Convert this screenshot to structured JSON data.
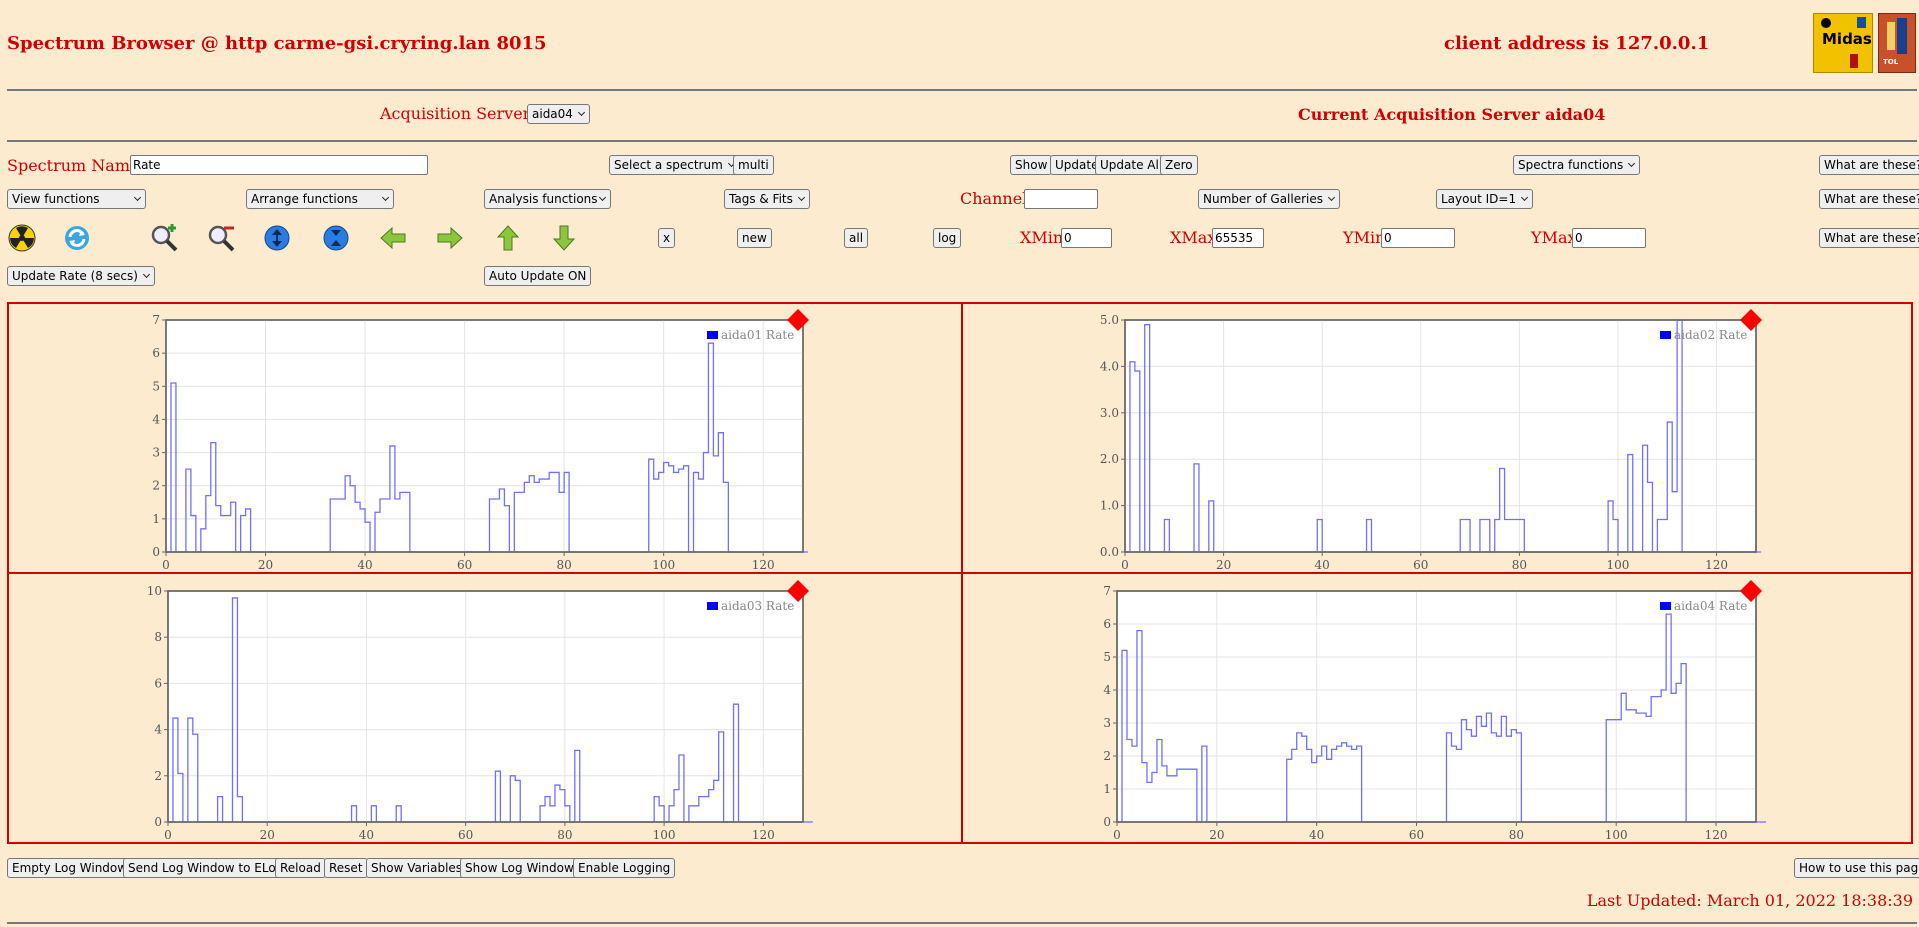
{
  "header": {
    "title": "Spectrum Browser @ http carme-gsi.cryring.lan 8015",
    "client_address": "client address is 127.0.0.1",
    "logos": [
      "Midas",
      "TOL"
    ]
  },
  "acquisition": {
    "label": "Acquisition Servers",
    "selected": "aida04",
    "current": "Current Acquisition Server aida04"
  },
  "row1": {
    "spectrum_label": "Spectrum Name:",
    "spectrum_value": "Rate",
    "select_spectrum": "Select a spectrum",
    "multi": "multi",
    "show": "Show",
    "update": "Update",
    "update_all": "Update All",
    "zero": "Zero",
    "spectra_functions": "Spectra functions",
    "what": "What are these?"
  },
  "row2": {
    "view_functions": "View functions",
    "arrange_functions": "Arrange functions",
    "analysis_functions": "Analysis functions",
    "tags_fits": "Tags & Fits",
    "channel_label": "Channel:",
    "channel_value": "",
    "galleries": "Number of Galleries",
    "layout": "Layout ID=1",
    "what": "What are these?"
  },
  "row3": {
    "x": "x",
    "new": "new",
    "all": "all",
    "log": "log",
    "xmin_label": "XMin",
    "xmin": "0",
    "xmax_label": "XMax",
    "xmax": "65535",
    "ymin_label": "YMin",
    "ymin": "0",
    "ymax_label": "YMax",
    "ymax": "0",
    "what": "What are these?",
    "icons": [
      "radiation-icon",
      "refresh-icon",
      "zoom-in-icon",
      "zoom-out-icon",
      "expand-y-icon",
      "compress-y-icon",
      "arrow-left-icon",
      "arrow-right-icon",
      "arrow-up-icon",
      "arrow-down-icon"
    ]
  },
  "row4": {
    "update_rate": "Update Rate (8 secs)",
    "auto_update": "Auto Update ON"
  },
  "footer": {
    "empty_log": "Empty Log Window",
    "send_log": "Send Log Window to ELog",
    "reload": "Reload",
    "reset": "Reset",
    "show_variables": "Show Variables",
    "show_log": "Show Log Window",
    "enable_logging": "Enable Logging",
    "how_to": "How to use this page",
    "last_updated": "Last Updated: March 01, 2022 18:38:39"
  },
  "colors": {
    "accent": "#d00000",
    "background": "#fdebd0",
    "trace": "#7070ff",
    "legend": "#0000ff",
    "marker": "#ff0000"
  },
  "chart_data": [
    {
      "type": "line",
      "series": [
        {
          "name": "aida01 Rate",
          "x_start": 0,
          "x_step": 1,
          "values": [
            0,
            5.1,
            0,
            0,
            2.5,
            1.1,
            0,
            0.7,
            1.7,
            3.3,
            1.4,
            1.1,
            1.1,
            1.5,
            0,
            1.1,
            1.3,
            0,
            0,
            0,
            0,
            0,
            0,
            0,
            0,
            0,
            0,
            0,
            0,
            0,
            0,
            0,
            0,
            1.6,
            1.6,
            1.6,
            2.3,
            2.0,
            1.5,
            1.3,
            0.9,
            0,
            1.2,
            1.6,
            1.6,
            3.2,
            1.6,
            1.8,
            1.8,
            0,
            0,
            0,
            0,
            0,
            0,
            0,
            0,
            0,
            0,
            0,
            0,
            0,
            0,
            0,
            0,
            1.6,
            1.6,
            1.9,
            1.4,
            0,
            1.8,
            1.8,
            2.1,
            2.3,
            2.1,
            2.2,
            2.2,
            2.4,
            2.4,
            1.8,
            2.4,
            0,
            0,
            0,
            0,
            0,
            0,
            0,
            0,
            0,
            0,
            0,
            0,
            0,
            0,
            0,
            0,
            2.8,
            2.2,
            2.4,
            2.7,
            2.6,
            2.4,
            2.5,
            2.6,
            0,
            2.4,
            2.2,
            3.0,
            6.3,
            2.9,
            3.6,
            2.1,
            0,
            0,
            0,
            0,
            0,
            0,
            0,
            0,
            0,
            0,
            0,
            0,
            0,
            0,
            0,
            0
          ]
        }
      ],
      "xlim": [
        0,
        128
      ],
      "ylim": [
        0,
        7
      ],
      "xticks": [
        0,
        20,
        40,
        60,
        80,
        100,
        120
      ],
      "yticks": [
        0,
        1,
        2,
        3,
        4,
        5,
        6,
        7
      ],
      "ytick_labels": [
        "0",
        "1",
        "2",
        "3",
        "4",
        "5",
        "6",
        "7"
      ],
      "grid": true,
      "legend": "top-right"
    },
    {
      "type": "line",
      "series": [
        {
          "name": "aida02 Rate",
          "x_start": 0,
          "x_step": 1,
          "values": [
            0,
            4.1,
            3.9,
            0,
            4.9,
            0,
            0,
            0,
            0.7,
            0,
            0,
            0,
            0,
            0,
            1.9,
            0,
            0,
            1.1,
            0,
            0,
            0,
            0,
            0,
            0,
            0,
            0,
            0,
            0,
            0,
            0,
            0,
            0,
            0,
            0,
            0,
            0,
            0,
            0,
            0,
            0.7,
            0,
            0,
            0,
            0,
            0,
            0,
            0,
            0,
            0,
            0.7,
            0,
            0,
            0,
            0,
            0,
            0,
            0,
            0,
            0,
            0,
            0,
            0,
            0,
            0,
            0,
            0,
            0,
            0,
            0.7,
            0.7,
            0,
            0,
            0.7,
            0.7,
            0,
            0.7,
            1.8,
            0.7,
            0.7,
            0.7,
            0.7,
            0,
            0,
            0,
            0,
            0,
            0,
            0,
            0,
            0,
            0,
            0,
            0,
            0,
            0,
            0,
            0,
            0,
            1.1,
            0.7,
            0,
            0,
            2.1,
            0,
            0,
            2.3,
            1.5,
            0,
            0.7,
            0.7,
            2.8,
            1.3,
            5.0,
            0,
            0,
            0,
            0,
            0,
            0,
            0,
            0,
            0,
            0,
            0,
            0,
            0,
            0,
            0,
            0
          ]
        }
      ],
      "xlim": [
        0,
        128
      ],
      "ylim": [
        0,
        5
      ],
      "xticks": [
        0,
        20,
        40,
        60,
        80,
        100,
        120
      ],
      "yticks": [
        0,
        1,
        2,
        3,
        4,
        5
      ],
      "ytick_labels": [
        "0.0",
        "1.0",
        "2.0",
        "3.0",
        "4.0",
        "5.0"
      ],
      "grid": true,
      "legend": "top-right"
    },
    {
      "type": "line",
      "series": [
        {
          "name": "aida03 Rate",
          "x_start": 0,
          "x_step": 1,
          "values": [
            0,
            4.5,
            2.1,
            0,
            4.5,
            3.8,
            0,
            0,
            0,
            0,
            1.1,
            0,
            0,
            9.7,
            1.1,
            0,
            0,
            0,
            0,
            0,
            0,
            0,
            0,
            0,
            0,
            0,
            0,
            0,
            0,
            0,
            0,
            0,
            0,
            0,
            0,
            0,
            0,
            0.7,
            0,
            0,
            0,
            0.7,
            0,
            0,
            0,
            0,
            0.7,
            0,
            0,
            0,
            0,
            0,
            0,
            0,
            0,
            0,
            0,
            0,
            0,
            0,
            0,
            0,
            0,
            0,
            0,
            0,
            2.2,
            0,
            0,
            2.0,
            1.8,
            0,
            0,
            0,
            0,
            0.7,
            1.1,
            0.7,
            1.6,
            1.4,
            0.7,
            0,
            3.1,
            0,
            0,
            0,
            0,
            0,
            0,
            0,
            0,
            0,
            0,
            0,
            0,
            0,
            0,
            0,
            1.1,
            0.7,
            0,
            0.7,
            1.4,
            2.9,
            0,
            0.7,
            0.7,
            1.1,
            1.1,
            1.4,
            1.8,
            3.9,
            0,
            0,
            5.1,
            0,
            0,
            0,
            0,
            0,
            0,
            0,
            0,
            0,
            0,
            0,
            0,
            0,
            0,
            0
          ]
        }
      ],
      "xlim": [
        0,
        128
      ],
      "ylim": [
        0,
        10
      ],
      "xticks": [
        0,
        20,
        40,
        60,
        80,
        100,
        120
      ],
      "yticks": [
        0,
        2,
        4,
        6,
        8,
        10
      ],
      "ytick_labels": [
        "0",
        "2",
        "4",
        "6",
        "8",
        "10"
      ],
      "grid": true,
      "legend": "top-right"
    },
    {
      "type": "line",
      "series": [
        {
          "name": "aida04 Rate",
          "x_start": 0,
          "x_step": 1,
          "values": [
            0,
            5.2,
            2.5,
            2.3,
            5.8,
            1.8,
            1.2,
            1.5,
            2.5,
            1.7,
            1.4,
            1.4,
            1.6,
            1.6,
            1.6,
            1.6,
            0,
            2.3,
            0,
            0,
            0,
            0,
            0,
            0,
            0,
            0,
            0,
            0,
            0,
            0,
            0,
            0,
            0,
            0,
            1.9,
            2.2,
            2.7,
            2.6,
            2.2,
            1.8,
            2.0,
            2.3,
            1.9,
            2.2,
            2.3,
            2.4,
            2.3,
            2.2,
            2.3,
            0,
            0,
            0,
            0,
            0,
            0,
            0,
            0,
            0,
            0,
            0,
            0,
            0,
            0,
            0,
            0,
            0,
            2.7,
            2.3,
            2.2,
            3.1,
            2.8,
            2.6,
            3.2,
            2.9,
            3.3,
            2.7,
            2.6,
            3.2,
            2.6,
            2.8,
            2.7,
            0,
            0,
            0,
            0,
            0,
            0,
            0,
            0,
            0,
            0,
            0,
            0,
            0,
            0,
            0,
            0,
            0,
            3.1,
            3.1,
            3.1,
            3.9,
            3.4,
            3.4,
            3.3,
            3.3,
            3.2,
            3.8,
            3.8,
            4.0,
            6.3,
            3.9,
            4.2,
            4.8,
            0,
            0,
            0,
            0,
            0,
            0,
            0,
            0,
            0,
            0,
            0,
            0,
            0,
            0,
            0,
            0
          ]
        }
      ],
      "xlim": [
        0,
        128
      ],
      "ylim": [
        0,
        7
      ],
      "xticks": [
        0,
        20,
        40,
        60,
        80,
        100,
        120
      ],
      "yticks": [
        0,
        1,
        2,
        3,
        4,
        5,
        6,
        7
      ],
      "ytick_labels": [
        "0",
        "1",
        "2",
        "3",
        "4",
        "5",
        "6",
        "7"
      ],
      "grid": true,
      "legend": "top-right"
    }
  ]
}
